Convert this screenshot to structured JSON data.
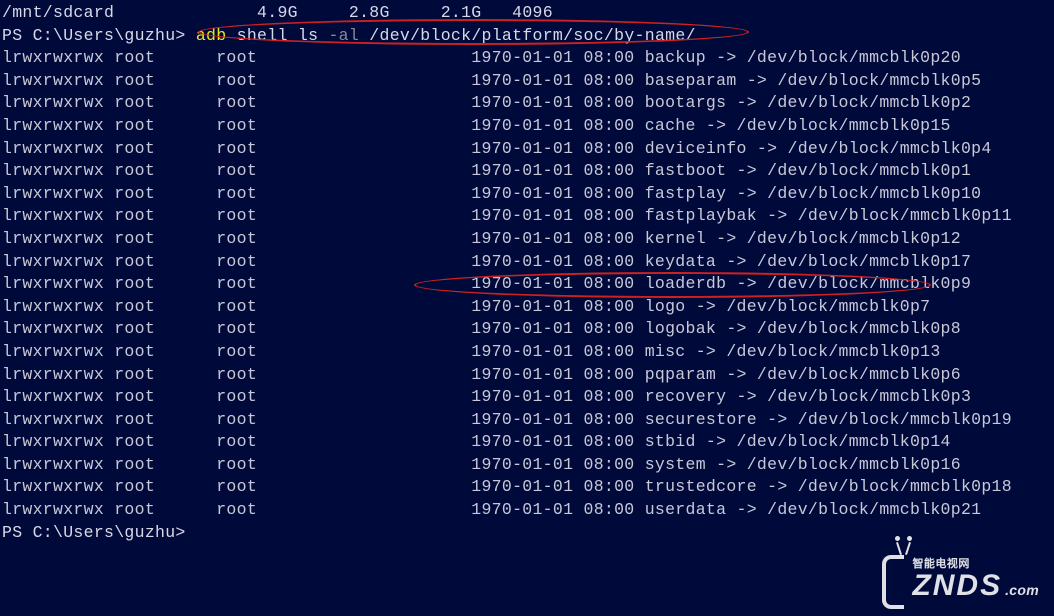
{
  "top_row": {
    "path": "/mnt/sdcard",
    "size": "4.9G",
    "used": "2.8G",
    "avail": "2.1G",
    "blk": "4096"
  },
  "cmd_line": {
    "prompt": "PS C:\\Users\\guzhu>",
    "cmd_adb": "adb",
    "cmd_shell_ls": "shell ls",
    "cmd_flag": "-al",
    "cmd_path": "/dev/block/platform/soc/by-name/"
  },
  "listing": [
    {
      "perm": "lrwxrwxrwx",
      "owner": "root",
      "group": "root",
      "date": "1970-01-01 08:00",
      "name": "backup",
      "arrow": "->",
      "target": "/dev/block/mmcblk0p20"
    },
    {
      "perm": "lrwxrwxrwx",
      "owner": "root",
      "group": "root",
      "date": "1970-01-01 08:00",
      "name": "baseparam",
      "arrow": "->",
      "target": "/dev/block/mmcblk0p5"
    },
    {
      "perm": "lrwxrwxrwx",
      "owner": "root",
      "group": "root",
      "date": "1970-01-01 08:00",
      "name": "bootargs",
      "arrow": "->",
      "target": "/dev/block/mmcblk0p2"
    },
    {
      "perm": "lrwxrwxrwx",
      "owner": "root",
      "group": "root",
      "date": "1970-01-01 08:00",
      "name": "cache",
      "arrow": "->",
      "target": "/dev/block/mmcblk0p15"
    },
    {
      "perm": "lrwxrwxrwx",
      "owner": "root",
      "group": "root",
      "date": "1970-01-01 08:00",
      "name": "deviceinfo",
      "arrow": "->",
      "target": "/dev/block/mmcblk0p4"
    },
    {
      "perm": "lrwxrwxrwx",
      "owner": "root",
      "group": "root",
      "date": "1970-01-01 08:00",
      "name": "fastboot",
      "arrow": "->",
      "target": "/dev/block/mmcblk0p1"
    },
    {
      "perm": "lrwxrwxrwx",
      "owner": "root",
      "group": "root",
      "date": "1970-01-01 08:00",
      "name": "fastplay",
      "arrow": "->",
      "target": "/dev/block/mmcblk0p10"
    },
    {
      "perm": "lrwxrwxrwx",
      "owner": "root",
      "group": "root",
      "date": "1970-01-01 08:00",
      "name": "fastplaybak",
      "arrow": "->",
      "target": "/dev/block/mmcblk0p11"
    },
    {
      "perm": "lrwxrwxrwx",
      "owner": "root",
      "group": "root",
      "date": "1970-01-01 08:00",
      "name": "kernel",
      "arrow": "->",
      "target": "/dev/block/mmcblk0p12"
    },
    {
      "perm": "lrwxrwxrwx",
      "owner": "root",
      "group": "root",
      "date": "1970-01-01 08:00",
      "name": "keydata",
      "arrow": "->",
      "target": "/dev/block/mmcblk0p17"
    },
    {
      "perm": "lrwxrwxrwx",
      "owner": "root",
      "group": "root",
      "date": "1970-01-01 08:00",
      "name": "loaderdb",
      "arrow": "->",
      "target": "/dev/block/mmcblk0p9"
    },
    {
      "perm": "lrwxrwxrwx",
      "owner": "root",
      "group": "root",
      "date": "1970-01-01 08:00",
      "name": "logo",
      "arrow": "->",
      "target": "/dev/block/mmcblk0p7"
    },
    {
      "perm": "lrwxrwxrwx",
      "owner": "root",
      "group": "root",
      "date": "1970-01-01 08:00",
      "name": "logobak",
      "arrow": "->",
      "target": "/dev/block/mmcblk0p8"
    },
    {
      "perm": "lrwxrwxrwx",
      "owner": "root",
      "group": "root",
      "date": "1970-01-01 08:00",
      "name": "misc",
      "arrow": "->",
      "target": "/dev/block/mmcblk0p13"
    },
    {
      "perm": "lrwxrwxrwx",
      "owner": "root",
      "group": "root",
      "date": "1970-01-01 08:00",
      "name": "pqparam",
      "arrow": "->",
      "target": "/dev/block/mmcblk0p6"
    },
    {
      "perm": "lrwxrwxrwx",
      "owner": "root",
      "group": "root",
      "date": "1970-01-01 08:00",
      "name": "recovery",
      "arrow": "->",
      "target": "/dev/block/mmcblk0p3"
    },
    {
      "perm": "lrwxrwxrwx",
      "owner": "root",
      "group": "root",
      "date": "1970-01-01 08:00",
      "name": "securestore",
      "arrow": "->",
      "target": "/dev/block/mmcblk0p19"
    },
    {
      "perm": "lrwxrwxrwx",
      "owner": "root",
      "group": "root",
      "date": "1970-01-01 08:00",
      "name": "stbid",
      "arrow": "->",
      "target": "/dev/block/mmcblk0p14"
    },
    {
      "perm": "lrwxrwxrwx",
      "owner": "root",
      "group": "root",
      "date": "1970-01-01 08:00",
      "name": "system",
      "arrow": "->",
      "target": "/dev/block/mmcblk0p16"
    },
    {
      "perm": "lrwxrwxrwx",
      "owner": "root",
      "group": "root",
      "date": "1970-01-01 08:00",
      "name": "trustedcore",
      "arrow": "->",
      "target": "/dev/block/mmcblk0p18"
    },
    {
      "perm": "lrwxrwxrwx",
      "owner": "root",
      "group": "root",
      "date": "1970-01-01 08:00",
      "name": "userdata",
      "arrow": "->",
      "target": "/dev/block/mmcblk0p21"
    }
  ],
  "end_prompt": "PS C:\\Users\\guzhu>",
  "watermark": {
    "tagline": "智能电视网",
    "brand": "ZNDS",
    "suffix": ".com"
  }
}
